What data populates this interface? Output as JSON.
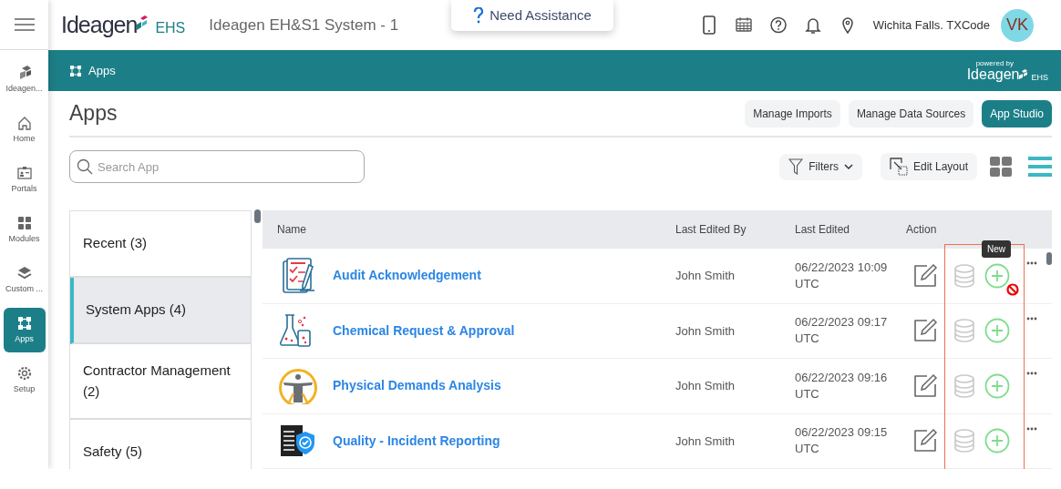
{
  "header": {
    "logo": "Ideagen",
    "logo_suffix": "EHS",
    "system_title": "Ideagen EH&S1 System - 1",
    "assistance": "Need Assistance",
    "location": "Wichita Falls. TXCode",
    "avatar": "VK"
  },
  "rail": [
    {
      "kind": "brand",
      "label": "Ideagen...",
      "selected": false
    },
    {
      "kind": "home",
      "label": "Home",
      "selected": false
    },
    {
      "kind": "portals",
      "label": "Portals",
      "selected": false
    },
    {
      "kind": "modules",
      "label": "Modules",
      "selected": false
    },
    {
      "kind": "custom",
      "label": "Custom ...",
      "selected": false
    },
    {
      "kind": "apps",
      "label": "Apps",
      "selected": true
    },
    {
      "kind": "setup",
      "label": "Setup",
      "selected": false
    }
  ],
  "breadcrumb": {
    "label": "Apps",
    "powered_by": "powered by",
    "brand": "Ideagen",
    "brand_suffix": "EHS"
  },
  "page": {
    "title": "Apps",
    "buttons": [
      {
        "label": "Manage Imports",
        "kind": "secondary"
      },
      {
        "label": "Manage Data Sources",
        "kind": "secondary"
      },
      {
        "label": "App Studio",
        "kind": "primary"
      }
    ],
    "search": {
      "placeholder": "Search App"
    },
    "filters": "Filters",
    "edit_layout": "Edit Layout",
    "views": [
      {
        "kind": "grid",
        "selected": false
      },
      {
        "kind": "list",
        "selected": true
      }
    ]
  },
  "categories": [
    {
      "label": "Recent (3)",
      "selected": false
    },
    {
      "label": "System Apps (4)",
      "selected": true
    },
    {
      "label": "Contractor Management (2)",
      "selected": false
    },
    {
      "label": "Safety (5)",
      "selected": false
    }
  ],
  "table": {
    "columns": [
      "Name",
      "Last Edited By",
      "Last Edited",
      "Action"
    ],
    "rows": [
      {
        "kind": "audit",
        "name": "Audit Acknowledgement",
        "editor": "John Smith",
        "edited": "06/22/2023 10:09 UTC",
        "tooltip": "New",
        "blocked": true
      },
      {
        "kind": "chemical",
        "name": "Chemical Request & Approval",
        "editor": "John Smith",
        "edited": "06/22/2023 09:17 UTC",
        "blocked": false
      },
      {
        "kind": "physical",
        "name": "Physical Demands Analysis",
        "editor": "John Smith",
        "edited": "06/22/2023 09:16 UTC",
        "blocked": false
      },
      {
        "kind": "quality",
        "name": "Quality - Incident Reporting",
        "editor": "John Smith",
        "edited": "06/22/2023 09:15 UTC",
        "blocked": false
      }
    ],
    "highlight_actions": true
  }
}
